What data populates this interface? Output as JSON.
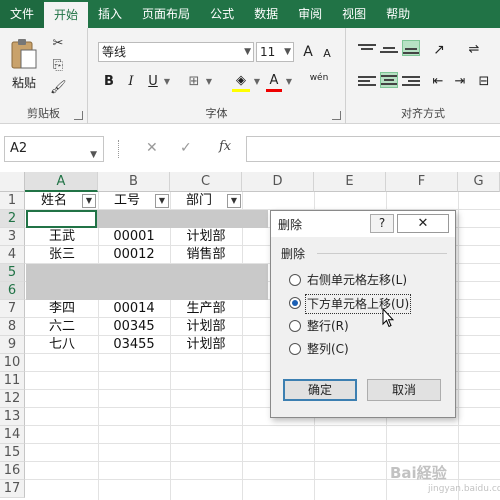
{
  "ribbon": {
    "tabs": [
      "文件",
      "开始",
      "插入",
      "页面布局",
      "公式",
      "数据",
      "审阅",
      "视图",
      "帮助"
    ],
    "active_tab": "开始",
    "clipboard": {
      "paste_label": "粘贴",
      "group_label": "剪贴板"
    },
    "font": {
      "font_name": "等线",
      "font_size": "11",
      "bold": "B",
      "italic": "I",
      "underline": "U",
      "grow": "A",
      "shrink": "A",
      "group_label": "字体",
      "phonetic": "wén"
    },
    "alignment": {
      "group_label": "对齐方式"
    }
  },
  "formula_bar": {
    "name_box": "A2",
    "fx": "fx",
    "formula": ""
  },
  "grid": {
    "columns": [
      "A",
      "B",
      "C",
      "D",
      "E",
      "F",
      "G"
    ],
    "selected_column": "A",
    "rows": [
      "1",
      "2",
      "3",
      "4",
      "5",
      "6",
      "7",
      "8",
      "9",
      "10",
      "11",
      "12",
      "13",
      "14",
      "15",
      "16",
      "17"
    ],
    "selected_rows": [
      "2",
      "5",
      "6"
    ],
    "active_cell": "A2",
    "headers": [
      "姓名",
      "工号",
      "部门"
    ],
    "data": [
      {
        "row": "3",
        "name": "王武",
        "id": "00001",
        "dept": "计划部"
      },
      {
        "row": "4",
        "name": "张三",
        "id": "00012",
        "dept": "销售部"
      },
      {
        "row": "7",
        "name": "李四",
        "id": "00014",
        "dept": "生产部"
      },
      {
        "row": "8",
        "name": "六二",
        "id": "00345",
        "dept": "计划部"
      },
      {
        "row": "9",
        "name": "七八",
        "id": "03455",
        "dept": "计划部"
      }
    ]
  },
  "dialog": {
    "title": "删除",
    "help": "?",
    "close": "✕",
    "group_label": "删除",
    "options": [
      {
        "label": "右侧单元格左移(L)",
        "selected": false
      },
      {
        "label": "下方单元格上移(U)",
        "selected": true
      },
      {
        "label": "整行(R)",
        "selected": false
      },
      {
        "label": "整列(C)",
        "selected": false
      }
    ],
    "ok": "确定",
    "cancel": "取消"
  },
  "watermark": {
    "text": "Bai経验",
    "sub": "jingyan.baidu.com"
  }
}
